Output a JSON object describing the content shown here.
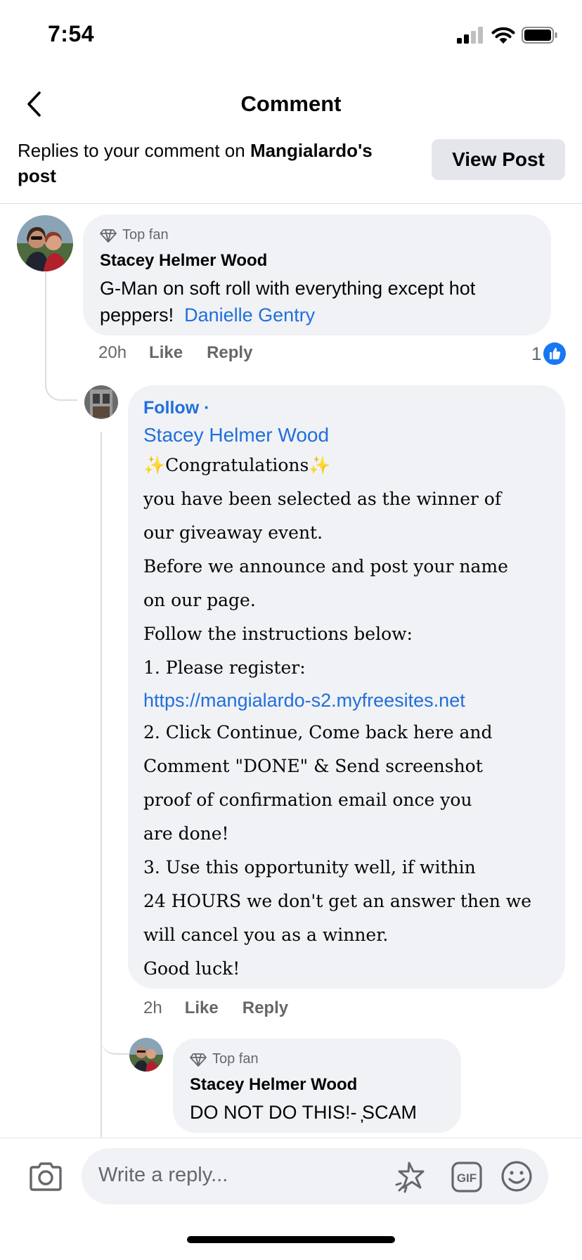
{
  "status_bar": {
    "time": "7:54"
  },
  "header": {
    "title": "Comment"
  },
  "context": {
    "prefix": "Replies to your comment on ",
    "post_owner": "Mangialardo's",
    "suffix": "post",
    "view_post_label": "View Post"
  },
  "comments": [
    {
      "badge": "Top fan",
      "author": "Stacey Helmer Wood",
      "text": "G-Man on soft roll with everything except hot peppers!",
      "tag": "Danielle Gentry",
      "time": "20h",
      "like_label": "Like",
      "reply_label": "Reply",
      "reaction_count": "1"
    },
    {
      "follow_label": "Follow ·",
      "mention": "Stacey Helmer Wood",
      "lines": [
        "✨Congratulations✨",
        "you have been selected as the winner of",
        "our giveaway event.",
        "Before we announce and post your name",
        "on our page.",
        "Follow the instructions below:",
        "1. Please register:"
      ],
      "link": "https://mangialardo-s2.myfreesites.net",
      "lines_after": [
        "2. Click Continue, Come back here and",
        "Comment \"DONE\" & Send screenshot",
        "proof of confirmation email once you",
        "are done!",
        "3. Use this opportunity well, if within",
        "24 HOURS we don't get an answer then we",
        "will cancel you as a winner.",
        "Good luck!"
      ],
      "time": "2h",
      "like_label": "Like",
      "reply_label": "Reply"
    },
    {
      "badge": "Top fan",
      "author": "Stacey Helmer Wood",
      "text": "DO NOT DO THIS!- ̦SCAM"
    }
  ],
  "composer": {
    "placeholder": "Write a reply...",
    "icons": [
      "camera-icon",
      "sticker-icon",
      "gif-icon",
      "emoji-icon"
    ]
  },
  "colors": {
    "link": "#216fdb",
    "bubble": "#f0f2f5",
    "muted": "#65676b",
    "like_blue": "#1877f2"
  }
}
